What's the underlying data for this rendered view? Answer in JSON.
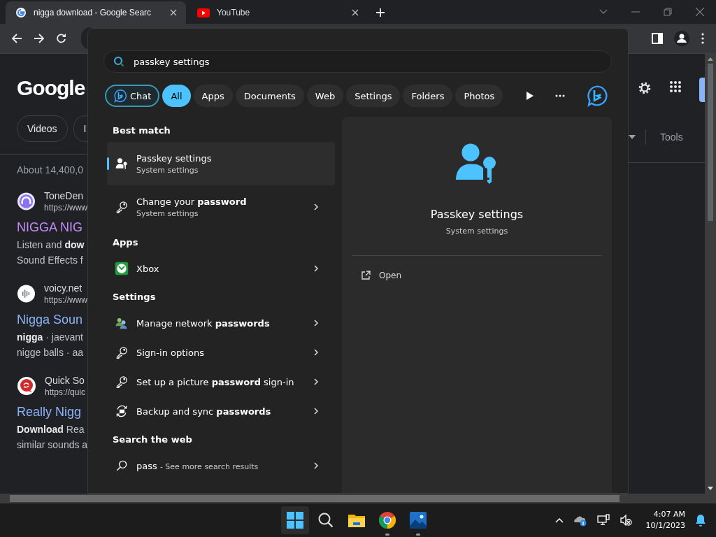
{
  "browser": {
    "tabs": [
      {
        "title": "nigga download - Google Searc",
        "kind": "google",
        "selected": true
      },
      {
        "title": "YouTube",
        "kind": "youtube",
        "selected": false
      }
    ]
  },
  "page": {
    "logo": "Google",
    "chips": [
      "Videos",
      "I"
    ],
    "tools": "Tools",
    "result_count": "About 14,400,0",
    "results": [
      {
        "kind": "headphones",
        "site": "ToneDen",
        "url": "https://www",
        "title": "NIGGA NIG",
        "visited": true,
        "snippet": [
          "Listen and **dow**",
          "Sound Effects f"
        ]
      },
      {
        "kind": "bars",
        "site": "voicy.net",
        "url": "https://www",
        "title": "Nigga Soun",
        "visited": false,
        "snippet": [
          "**nigga** · jaevant",
          "nigge balls · aa"
        ]
      },
      {
        "kind": "bubble",
        "site": "Quick So",
        "url": "https://quic",
        "title": "Really Nigg",
        "visited": false,
        "snippet": [
          "**Download** Rea",
          "similar sounds a"
        ]
      }
    ]
  },
  "start_menu": {
    "search": {
      "value": "passkey settings"
    },
    "filters": [
      {
        "label": "Chat",
        "kind": "chat",
        "selected": false
      },
      {
        "label": "All",
        "kind": "plain",
        "selected": true
      },
      {
        "label": "Apps",
        "kind": "plain",
        "selected": false
      },
      {
        "label": "Documents",
        "kind": "plain",
        "selected": false
      },
      {
        "label": "Web",
        "kind": "plain",
        "selected": false
      },
      {
        "label": "Settings",
        "kind": "plain",
        "selected": false
      },
      {
        "label": "Folders",
        "kind": "plain",
        "selected": false
      },
      {
        "label": "Photos",
        "kind": "plain",
        "selected": false
      }
    ],
    "sections": [
      {
        "heading": "Best match",
        "items": [
          {
            "kind": "person-key",
            "title": "Passkey settings",
            "subtitle": "System settings",
            "selected": true
          },
          {
            "kind": "key",
            "title": "Change your **password**",
            "subtitle": "System settings",
            "selected": false
          }
        ]
      },
      {
        "heading": "Apps",
        "items": [
          {
            "kind": "xbox",
            "title": "Xbox",
            "selected": false
          }
        ]
      },
      {
        "heading": "Settings",
        "items": [
          {
            "kind": "network",
            "title": "Manage network **passwords**",
            "selected": false
          },
          {
            "kind": "key",
            "title": "Sign-in options",
            "selected": false
          },
          {
            "kind": "key",
            "title": "Set up a picture **password** sign-in",
            "selected": false
          },
          {
            "kind": "sync",
            "title": "Backup and sync **passwords**",
            "selected": false
          }
        ]
      },
      {
        "heading": "Search the web",
        "items": [
          {
            "kind": "search",
            "title": "pass",
            "subtitle": "- See more search results",
            "selected": false
          }
        ]
      }
    ],
    "preview": {
      "title": "Passkey settings",
      "subtitle": "System settings",
      "actions": [
        "Open"
      ]
    }
  },
  "taskbar": {
    "apps": [
      {
        "kind": "start",
        "active": true,
        "running": false
      },
      {
        "kind": "search",
        "active": false,
        "running": false
      },
      {
        "kind": "explorer",
        "active": false,
        "running": false
      },
      {
        "kind": "chrome",
        "active": false,
        "running": true
      },
      {
        "kind": "photos",
        "active": false,
        "running": true
      }
    ],
    "time": "4:07 AM",
    "date": "10/1/2023"
  }
}
